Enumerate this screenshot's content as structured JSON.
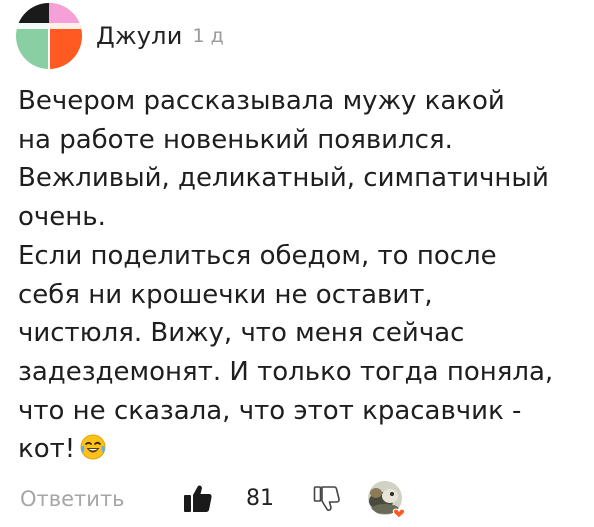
{
  "comment": {
    "author": "Джули",
    "timestamp": "1 д",
    "body_lines": [
      "Вечером рассказывала мужу какой",
      "на работе новенький появился.",
      "Вежливый, деликатный, симпатичный",
      "очень.",
      "Если поделиться обедом, то после",
      "себя ни  крошечки не оставит,",
      "чистюля. Вижу, что меня сейчас",
      "задездемонят. И только тогда поняла,",
      "что не сказала, что этот красавчик -",
      "кот!"
    ],
    "emoji": "tears-of-joy-emoji"
  },
  "actions": {
    "reply_label": "Ответить",
    "like_count": "81"
  },
  "avatar_colors": {
    "left": "#89cfa3",
    "right": "#fe5a22",
    "top_left": "#1a1a1a",
    "top_right": "#f5a0d8"
  },
  "icons": {
    "like": "thumbs-up-icon",
    "dislike": "thumbs-down-icon"
  }
}
